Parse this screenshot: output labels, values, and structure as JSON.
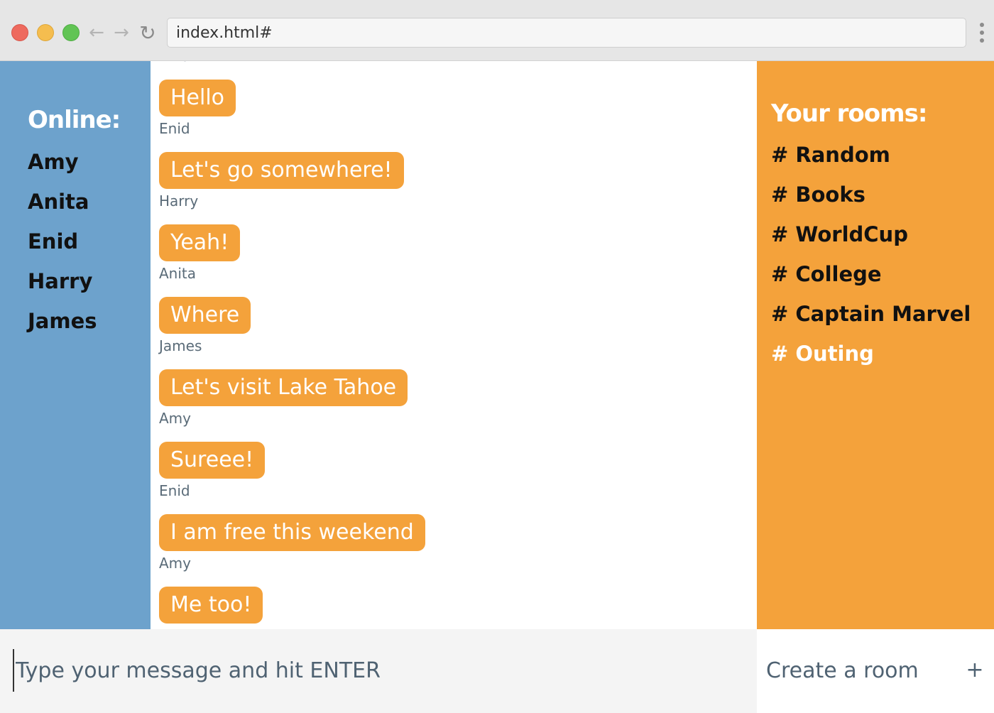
{
  "browser": {
    "url": "index.html#",
    "back_icon": "←",
    "forward_icon": "→",
    "reload_icon": "↻"
  },
  "online": {
    "title": "Online:",
    "users": [
      "Amy",
      "Anita",
      "Enid",
      "Harry",
      "James"
    ]
  },
  "messages": [
    {
      "sender": "Enid",
      "text": "Hello"
    },
    {
      "sender": "Enid",
      "text": "Let's go somewhere!"
    },
    {
      "sender": "Harry",
      "text": "Yeah!"
    },
    {
      "sender": "Anita",
      "text": "Where"
    },
    {
      "sender": "James",
      "text": "Let's visit Lake Tahoe"
    },
    {
      "sender": "Amy",
      "text": "Sureee!"
    },
    {
      "sender": "Enid",
      "text": "I am free this weekend"
    },
    {
      "sender": "Amy",
      "text": "Me too!"
    }
  ],
  "rooms": {
    "title": "Your rooms:",
    "items": [
      "# Random",
      "# Books",
      "# WorldCup",
      "# College",
      "# Captain Marvel",
      "# Outing"
    ],
    "active": "# Outing"
  },
  "composer": {
    "placeholder": "Type your message and hit ENTER"
  },
  "create_room": {
    "placeholder": "Create a room",
    "button": "+"
  },
  "colors": {
    "online_bg": "#6da2cc",
    "rooms_bg": "#f4a23b",
    "bubble_bg": "#f4a23b"
  }
}
